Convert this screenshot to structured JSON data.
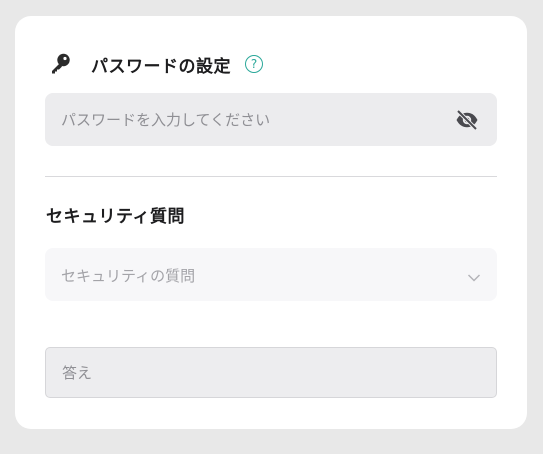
{
  "password_section": {
    "title": "パスワードの設定",
    "help_label": "?",
    "key_icon": "key-icon",
    "input": {
      "value": "",
      "placeholder": "パスワードを入力してください"
    },
    "visibility_icon": "eye-off-icon"
  },
  "security_section": {
    "title": "セキュリティ質問",
    "question_select": {
      "selected": "セキュリティの質問",
      "icon": "chevron-down-icon"
    },
    "answer_input": {
      "value": "",
      "placeholder": "答え"
    }
  },
  "colors": {
    "accent": "#2ba89a",
    "field_bg": "#ececee",
    "page_bg": "#e8e8e8"
  }
}
